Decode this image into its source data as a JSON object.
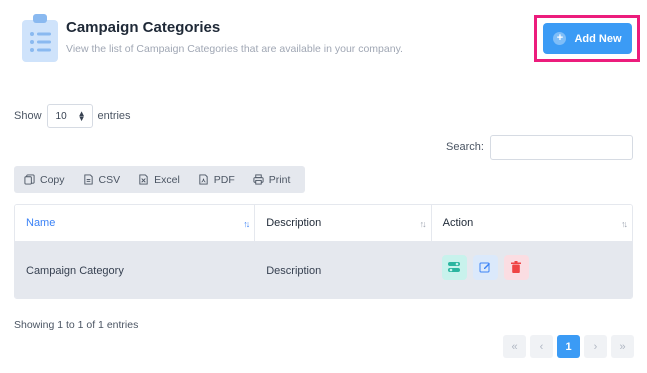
{
  "header": {
    "title": "Campaign Categories",
    "subtitle": "View the list of Campaign Categories that are available in your company.",
    "icon": "clipboard-list-icon",
    "add_button_label": "Add New"
  },
  "controls": {
    "show_label": "Show",
    "entries_value": "10",
    "entries_label": "entries",
    "search_label": "Search:",
    "search_value": ""
  },
  "export": {
    "buttons": [
      {
        "label": "Copy",
        "icon": "copy-icon"
      },
      {
        "label": "CSV",
        "icon": "csv-file-icon"
      },
      {
        "label": "Excel",
        "icon": "excel-file-icon"
      },
      {
        "label": "PDF",
        "icon": "pdf-file-icon"
      },
      {
        "label": "Print",
        "icon": "print-icon"
      }
    ]
  },
  "table": {
    "columns": [
      "Name",
      "Description",
      "Action"
    ],
    "rows": [
      {
        "name": "Campaign Category",
        "description": "Description"
      }
    ]
  },
  "footer": {
    "showing_text": "Showing 1 to 1 of 1 entries",
    "pagination": {
      "first": "«",
      "prev": "‹",
      "current": "1",
      "next": "›",
      "last": "»"
    }
  },
  "colors": {
    "accent": "#3b9bf5",
    "highlight_border": "#ec1c7c",
    "toggle_bg": "#c8f2ec",
    "edit_bg": "#dbe9fb",
    "delete_bg": "#fbdde2",
    "row_bg": "#e5e8ee"
  }
}
